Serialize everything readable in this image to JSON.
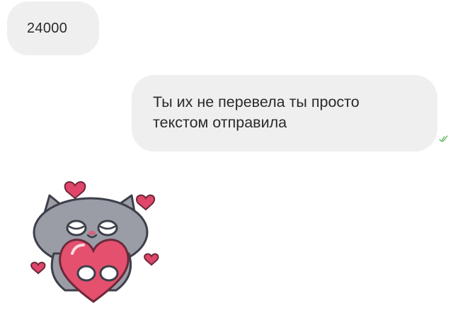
{
  "chat": {
    "incoming": {
      "text": "24000"
    },
    "outgoing": {
      "lines": [
        "Ты их не перевела ты просто",
        "текстом отправила"
      ],
      "status_icon": "double-check-icon"
    },
    "sticker": {
      "icon": "cat-hugging-heart-sticker"
    }
  },
  "colors": {
    "bubble": "#efefef",
    "text": "#2a2a2a",
    "read_check": "#4caf50",
    "heart": "#e0456a",
    "cat": "#9a9ca6"
  }
}
